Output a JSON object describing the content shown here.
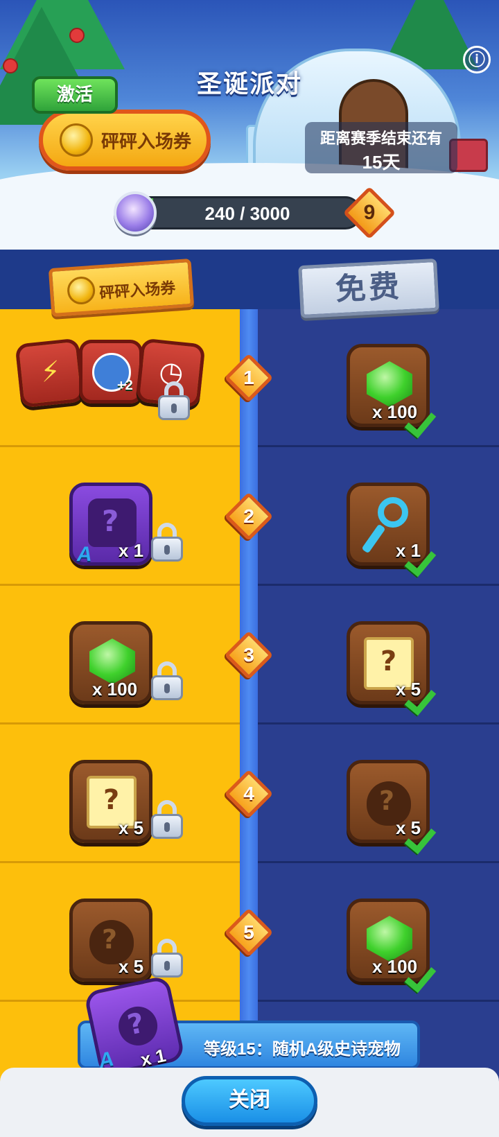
{
  "header": {
    "title": "圣诞派对",
    "activate_label": "激活",
    "ticket_label": "砰砰入场券",
    "season_label": "距离赛季结束还有",
    "season_days": "15天",
    "progress_text": "240 / 3000",
    "progress_fraction": 0.08,
    "current_level": "9",
    "info_icon": "ⓘ"
  },
  "columns": {
    "premium_label": "砰砰入场券",
    "free_label": "免费"
  },
  "rows": [
    {
      "level": "1",
      "premium": {
        "items": [
          "energy-boost",
          "sword-upgrade",
          "stopwatch"
        ],
        "plus": "+2",
        "locked": true
      },
      "free": {
        "item": "gem",
        "qty": "x 100",
        "claimed": true
      }
    },
    {
      "level": "2",
      "premium": {
        "item": "mystery-outfit",
        "grade": "A",
        "qty": "x 1",
        "locked": true
      },
      "free": {
        "item": "key",
        "qty": "x 1",
        "claimed": true
      }
    },
    {
      "level": "3",
      "premium": {
        "item": "gem",
        "qty": "x 100",
        "locked": true
      },
      "free": {
        "item": "mystery-scroll",
        "qty": "x 5",
        "claimed": true
      }
    },
    {
      "level": "4",
      "premium": {
        "item": "mystery-scroll",
        "qty": "x 5",
        "locked": true
      },
      "free": {
        "item": "mystery-fruit",
        "qty": "x 5",
        "claimed": true
      }
    },
    {
      "level": "5",
      "premium": {
        "item": "mystery-fruit",
        "qty": "x 5",
        "locked": true
      },
      "free": {
        "item": "gem",
        "qty": "x 100",
        "claimed": true
      }
    }
  ],
  "milestone": {
    "label": "等级15：随机A级史诗宠物",
    "grade": "A",
    "qty": "x 1"
  },
  "footer": {
    "close_label": "关闭"
  },
  "colors": {
    "premium_bg": "#fdbf0c",
    "free_bg": "#2a3e8f",
    "accent_blue": "#1a8fe6",
    "claimed_green": "#37c43a"
  }
}
